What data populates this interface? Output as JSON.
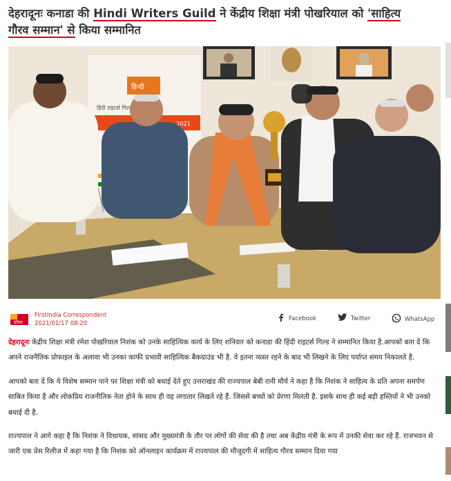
{
  "headline": {
    "part1": "देहरादूनः कनाडा की ",
    "highlight1": "Hindi Writers Guild",
    "part2": " ने केंद्रीय शिक्षा मंत्री पोखरियाल को ",
    "highlight2": "'साहित्य गौरव सम्मान' से",
    "part3": " किया सम्मानित"
  },
  "photo": {
    "banner_text": "हिंदी राइटर्स गिल्ड, कनाडा",
    "banner_year": "- 2021",
    "banner_logo": "हिन्दी"
  },
  "byline": {
    "logo_text": "इंडिया",
    "author": "FirstIndia Correspondent",
    "date": "2021/01/17 08:20"
  },
  "share": {
    "facebook": "Facebook",
    "twitter": "Twitter",
    "whatsapp": "WhatsApp"
  },
  "article": {
    "dateline": "देहरादूनः",
    "p1": " केंद्रीय शिक्षा मंत्री रमेश पोखरियाल निशंक को उनके साहित्यिक कार्य के लिए शनिवार को कनाडा की हिंदी राइटर्स गिल्ड ने सम्मानित किया है.आपको बता दें कि अपने राजनैतिक प्रोफाइल के अलावा भी उनका काफी प्रभावी साहित्यिक बैकग्राउंड भी है. वे इतना व्यस्त रहने के बाद भी लिखने के लिए पर्याप्त समय निकालते है.",
    "p2": "आपको बता दें कि ये विशेष सम्मान पाने पर शिक्षा मंत्री को बधाई देते हुए उत्तराखंड की राज्यपाल बेबी रानी मौर्य ने कहा है कि निशंक ने साहित्य के प्रति अपना समर्पण साबित किया है और लोकप्रिय राजनीतिक नेता होने के साथ ही वह लगातार लिखते रहे हैं. जिससे बच्चों को प्रेरणा मिलती है. इसके साथ ही कई बड़ी हस्तियों ने भी उनको बधाई दी है.",
    "p3": "राज्यपाल ने आगे कहा है कि निशंक ने विधायक, सांसद और मुख्यमंत्री के तौर पर लोगों की सेवा की है तथा अब केंद्रीय मंत्री के रूप में उनकी सेवा कर रहे हैं. राजभवन से जारी एक प्रेस रिलीज में कहा गया है कि निशंक को ऑनलाइन कार्यक्रम में राज्यपाल की मौजूदगी में साहित्य गौरव सम्मान दिया गया"
  },
  "colors": {
    "accent": "#d0021b",
    "table": "#c9a968",
    "wall": "#ece4d6"
  }
}
